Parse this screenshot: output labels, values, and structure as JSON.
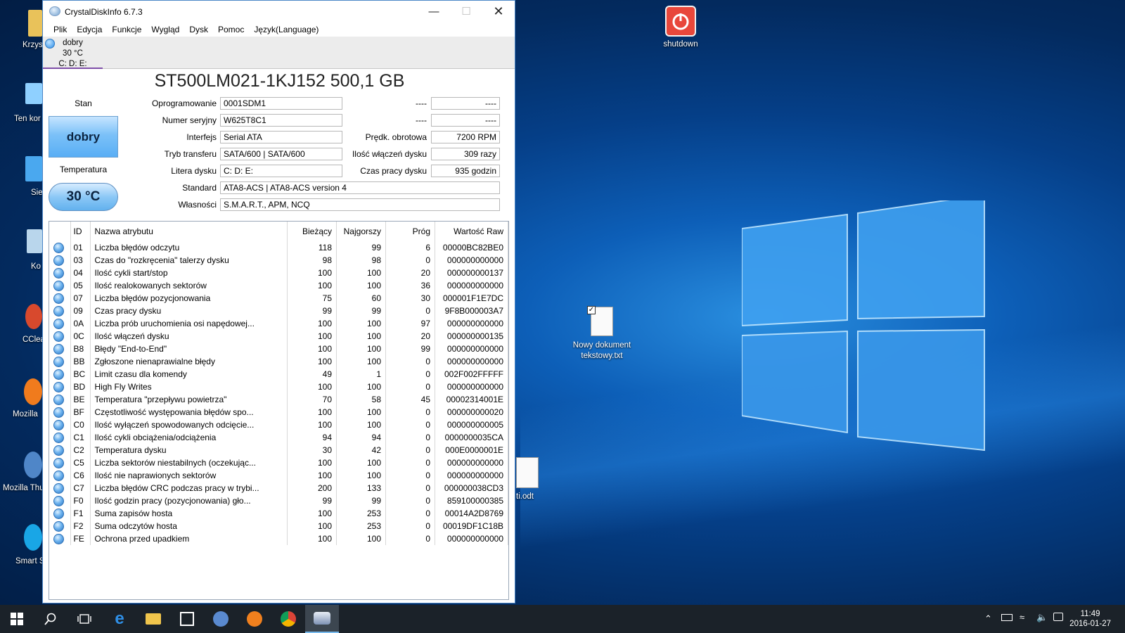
{
  "window": {
    "title": "CrystalDiskInfo 6.7.3",
    "menu": [
      "Plik",
      "Edycja",
      "Funkcje",
      "Wygląd",
      "Dysk",
      "Pomoc",
      "Język(Language)"
    ],
    "disk_tab": {
      "status": "dobry",
      "temp": "30 °C",
      "letters": "C: D: E:"
    },
    "model": "ST500LM021-1KJ152 500,1 GB",
    "health_label": "Stan",
    "health_value": "dobry",
    "temp_label": "Temperatura",
    "temp_value": "30 °C",
    "info": {
      "firmware_label": "Oprogramowanie",
      "firmware": "0001SDM1",
      "serial_label": "Numer seryjny",
      "serial": "W625T8C1",
      "interface_label": "Interfejs",
      "interface": "Serial ATA",
      "transfer_label": "Tryb transferu",
      "transfer": "SATA/600 | SATA/600",
      "letters_label": "Litera dysku",
      "letters": "C: D: E:",
      "standard_label": "Standard",
      "standard": "ATA8-ACS | ATA8-ACS version 4",
      "features_label": "Własności",
      "features": "S.M.A.R.T., APM, NCQ",
      "r1_label": "----",
      "r1_value": "----",
      "r2_label": "----",
      "r2_value": "----",
      "rpm_label": "Prędk. obrotowa",
      "rpm": "7200 RPM",
      "power_count_label": "Ilość włączeń dysku",
      "power_count": "309 razy",
      "hours_label": "Czas pracy dysku",
      "hours": "935 godzin"
    },
    "table": {
      "headers": [
        "ID",
        "Nazwa atrybutu",
        "Bieżący",
        "Najgorszy",
        "Próg",
        "Wartość Raw"
      ],
      "rows": [
        [
          "01",
          "Liczba błędów odczytu",
          "118",
          "99",
          "6",
          "00000BC82BE0"
        ],
        [
          "03",
          "Czas do \"rozkręcenia\" talerzy dysku",
          "98",
          "98",
          "0",
          "000000000000"
        ],
        [
          "04",
          "Ilość cykli start/stop",
          "100",
          "100",
          "20",
          "000000000137"
        ],
        [
          "05",
          "Ilość realokowanych sektorów",
          "100",
          "100",
          "36",
          "000000000000"
        ],
        [
          "07",
          "Liczba błędów pozycjonowania",
          "75",
          "60",
          "30",
          "000001F1E7DC"
        ],
        [
          "09",
          "Czas pracy dysku",
          "99",
          "99",
          "0",
          "9F8B000003A7"
        ],
        [
          "0A",
          "Liczba prób uruchomienia osi napędowej...",
          "100",
          "100",
          "97",
          "000000000000"
        ],
        [
          "0C",
          "Ilość włączeń dysku",
          "100",
          "100",
          "20",
          "000000000135"
        ],
        [
          "B8",
          "Błędy \"End-to-End\"",
          "100",
          "100",
          "99",
          "000000000000"
        ],
        [
          "BB",
          "Zgłoszone nienaprawialne błędy",
          "100",
          "100",
          "0",
          "000000000000"
        ],
        [
          "BC",
          "Limit czasu dla komendy",
          "49",
          "1",
          "0",
          "002F002FFFFF"
        ],
        [
          "BD",
          "High Fly Writes",
          "100",
          "100",
          "0",
          "000000000000"
        ],
        [
          "BE",
          "Temperatura \"przepływu powietrza\"",
          "70",
          "58",
          "45",
          "00002314001E"
        ],
        [
          "BF",
          "Częstotliwość występowania błędów spo...",
          "100",
          "100",
          "0",
          "000000000020"
        ],
        [
          "C0",
          "Ilość wyłączeń spowodowanych odcięcie...",
          "100",
          "100",
          "0",
          "000000000005"
        ],
        [
          "C1",
          "Ilość cykli obciążenia/odciążenia",
          "94",
          "94",
          "0",
          "0000000035CA"
        ],
        [
          "C2",
          "Temperatura dysku",
          "30",
          "42",
          "0",
          "000E0000001E"
        ],
        [
          "C5",
          "Liczba sektorów niestabilnych (oczekując...",
          "100",
          "100",
          "0",
          "000000000000"
        ],
        [
          "C6",
          "Ilość nie naprawionych sektorów",
          "100",
          "100",
          "0",
          "000000000000"
        ],
        [
          "C7",
          "Liczba błędów CRC podczas pracy w trybi...",
          "200",
          "133",
          "0",
          "000000038CD3"
        ],
        [
          "F0",
          "Ilość godzin pracy (pozycjonowania) gło...",
          "99",
          "99",
          "0",
          "859100000385"
        ],
        [
          "F1",
          "Suma zapisów hosta",
          "100",
          "253",
          "0",
          "00014A2D8769"
        ],
        [
          "F2",
          "Suma odczytów hosta",
          "100",
          "253",
          "0",
          "00019DF1C18B"
        ],
        [
          "FE",
          "Ochrona przed upadkiem",
          "100",
          "100",
          "0",
          "000000000000"
        ]
      ]
    }
  },
  "desktop": {
    "left_labels": [
      "Krzys",
      "Ten kor",
      "Sie",
      "Ko",
      "CClea",
      "Mozilla",
      "Mozilla Thu",
      "Smart S"
    ],
    "shutdown_label": "shutdown",
    "textfile_label": "Nowy dokument tekstowy.txt",
    "odt_label": "ti.odt"
  },
  "taskbar": {
    "time": "11:49",
    "date": "2016-01-27"
  },
  "colors": {
    "accent": "#4a86c7",
    "good": "#59aef5",
    "taskbar": "#1b2229"
  }
}
